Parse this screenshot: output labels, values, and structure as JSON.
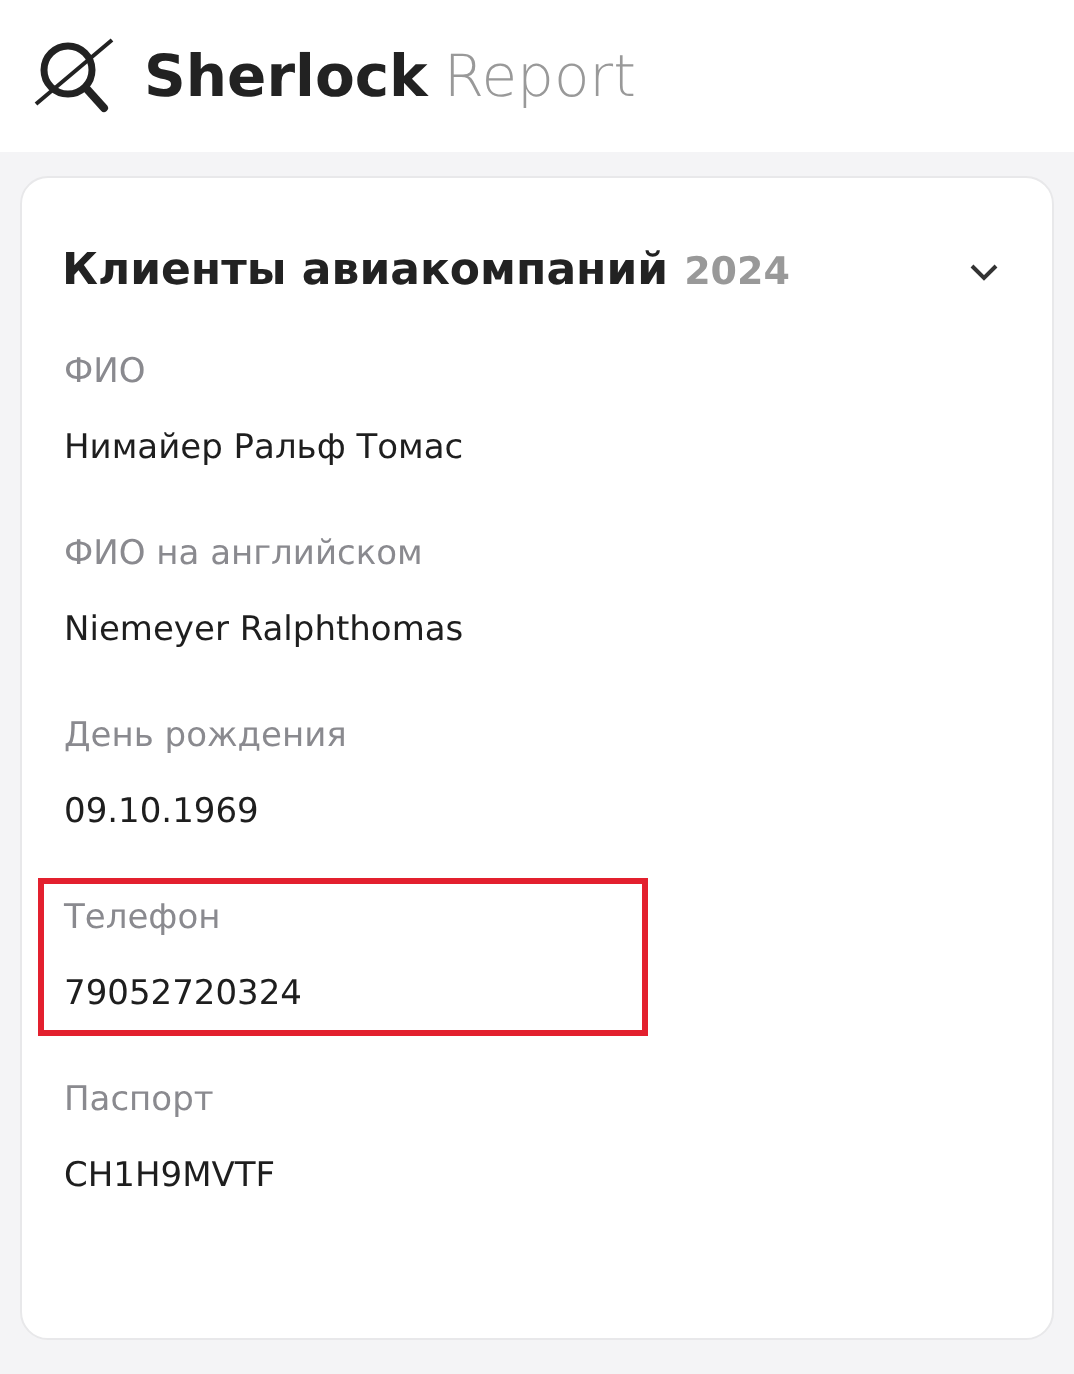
{
  "header": {
    "brand_bold": "Sherlock",
    "brand_light": "Report"
  },
  "card": {
    "title": "Клиенты авиакомпаний",
    "year": "2024",
    "expanded": true,
    "fields": [
      {
        "label": "ФИО",
        "value": "Нимайер Ральф Томас",
        "highlighted": false
      },
      {
        "label": "ФИО на английском",
        "value": "Niemeyer Ralphthomas",
        "highlighted": false
      },
      {
        "label": "День рождения",
        "value": "09.10.1969",
        "highlighted": false
      },
      {
        "label": "Телефон",
        "value": "79052720324",
        "highlighted": true
      },
      {
        "label": "Паспорт",
        "value": "CH1H9MVTF",
        "highlighted": false
      }
    ]
  }
}
